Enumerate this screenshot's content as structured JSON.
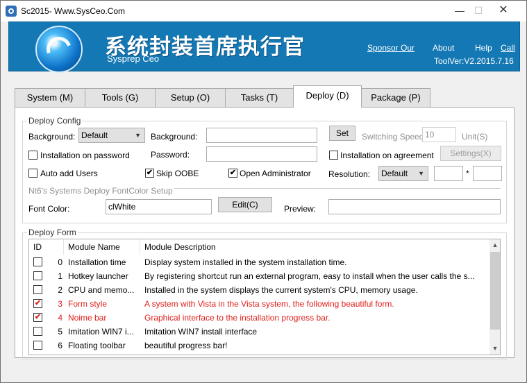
{
  "window": {
    "title": "Sc2015- Www.SysCeo.Com",
    "minimize": "—",
    "maximize": "☐",
    "close": "✕"
  },
  "banner": {
    "title_cn": "系统封装首席执行官",
    "subtitle": "Sysprep  Ceo",
    "links": {
      "sponsor": "Sponsor Our",
      "about": "About",
      "help": "Help",
      "call": "Call"
    },
    "version": "ToolVer:V2.2015.7.16"
  },
  "tabs": [
    {
      "label": "System (M)"
    },
    {
      "label": "Tools (G)"
    },
    {
      "label": "Setup (O)"
    },
    {
      "label": "Tasks (T)"
    },
    {
      "label": "Deploy (D)",
      "active": true
    },
    {
      "label": "Package (P)"
    }
  ],
  "deploy_config": {
    "title": "Deploy Config",
    "background_label": "Background:",
    "background_select": "Default",
    "background_path_label": "Background:",
    "background_path_value": "",
    "set_button": "Set",
    "switching_speed_label": "Switching Speed",
    "switching_speed_value": "10",
    "unit_label": "Unit(S)",
    "install_on_password": {
      "label": "Installation on password",
      "checked": false
    },
    "password_label": "Password:",
    "password_value": "",
    "install_on_agreement": {
      "label": "Installation on agreement",
      "checked": false
    },
    "settings_button": "Settings(X)",
    "auto_add_users": {
      "label": "Auto add Users",
      "checked": false
    },
    "skip_oobe": {
      "label": "Skip OOBE",
      "checked": true
    },
    "open_admin": {
      "label": "Open Administrator",
      "checked": true
    },
    "resolution_label": "Resolution:",
    "resolution_select": "Default",
    "resolution_w": "",
    "resolution_sep": "*",
    "resolution_h": "",
    "font_section_title": "Nt6's Systems Deploy FontColor Setup",
    "font_color_label": "Font Color:",
    "font_color_value": "clWhite",
    "edit_button": "Edit(C)",
    "preview_label": "Preview:",
    "preview_value": ""
  },
  "deploy_form": {
    "title": "Deploy Form",
    "columns": {
      "id": "ID",
      "name": "Module Name",
      "desc": "Module Description"
    },
    "rows": [
      {
        "checked": false,
        "id": "0",
        "name": "Installation time",
        "desc": "Display system installed in the system installation time.",
        "highlight": false
      },
      {
        "checked": false,
        "id": "1",
        "name": "Hotkey launcher",
        "desc": "By registering shortcut run an external program, easy to install when the user calls the s...",
        "highlight": false
      },
      {
        "checked": false,
        "id": "2",
        "name": "CPU and memo...",
        "desc": "Installed in the system displays the current system's CPU, memory usage.",
        "highlight": false
      },
      {
        "checked": true,
        "id": "3",
        "name": "Form style",
        "desc": "A system with Vista in the Vista system, the following beautiful form.",
        "highlight": true
      },
      {
        "checked": true,
        "id": "4",
        "name": "Noime bar",
        "desc": "Graphical interface to the installation progress bar.",
        "highlight": true
      },
      {
        "checked": false,
        "id": "5",
        "name": "Imitation WIN7 i...",
        "desc": "Imitation WIN7 install interface",
        "highlight": false
      },
      {
        "checked": false,
        "id": "6",
        "name": "Floating toolbar",
        "desc": "beautiful progress bar!",
        "highlight": false
      }
    ],
    "scroll_up": "▲",
    "scroll_down": "▼"
  },
  "colors": {
    "banner": "#1478b4",
    "highlight_text": "#e0201b"
  },
  "icons": {
    "app": "app-icon",
    "logo": "sysceo-logo",
    "checkmark": "✔"
  }
}
